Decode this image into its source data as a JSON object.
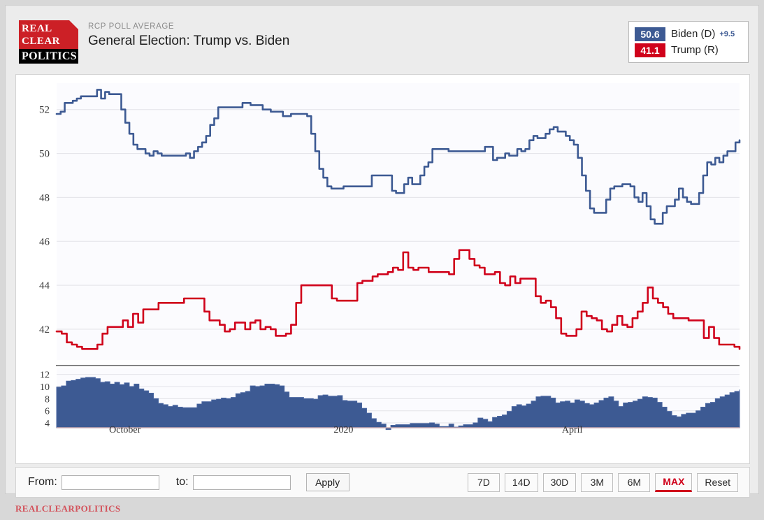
{
  "header": {
    "kicker": "RCP POLL AVERAGE",
    "title": "General Election: Trump vs. Biden",
    "logo": {
      "line1": "REAL",
      "line2": "CLEAR",
      "line3": "POLITICS"
    }
  },
  "legend": {
    "rows": [
      {
        "value": "50.6",
        "name": "Biden (D)",
        "delta": "+9.5",
        "color": "#3d5a93"
      },
      {
        "value": "41.1",
        "name": "Trump (R)",
        "delta": "",
        "color": "#d0021b"
      }
    ]
  },
  "controls": {
    "from_label": "From:",
    "from_value": "",
    "from_placeholder": "",
    "to_label": "to:",
    "to_value": "",
    "to_placeholder": "",
    "apply_label": "Apply",
    "ranges": [
      {
        "label": "7D",
        "active": false
      },
      {
        "label": "14D",
        "active": false
      },
      {
        "label": "30D",
        "active": false
      },
      {
        "label": "3M",
        "active": false
      },
      {
        "label": "6M",
        "active": false
      },
      {
        "label": "MAX",
        "active": true
      },
      {
        "label": "Reset",
        "active": false
      }
    ]
  },
  "footer": {
    "text": "REALCLEARPOLITICS"
  },
  "chart_data": {
    "type": "line",
    "title": "General Election: Trump vs. Biden",
    "subtitle": "RCP POLL AVERAGE",
    "xlabel": "",
    "ylabel": "",
    "ylim": [
      40.6,
      53.2
    ],
    "yticks": [
      42,
      44,
      46,
      48,
      50,
      52
    ],
    "grid": true,
    "legend_position": "top-right",
    "x_tick_labels": [
      "October",
      "2020",
      "April"
    ],
    "x_tick_positions": [
      0.1,
      0.42,
      0.755
    ],
    "series": [
      {
        "name": "Biden (D)",
        "color": "#3d5a93",
        "last_value": 50.6,
        "values": [
          51.8,
          51.9,
          52.3,
          52.3,
          52.4,
          52.5,
          52.6,
          52.6,
          52.6,
          52.6,
          52.9,
          52.5,
          52.8,
          52.7,
          52.7,
          52.7,
          52.0,
          51.4,
          50.9,
          50.4,
          50.2,
          50.2,
          50.0,
          49.9,
          50.1,
          50.0,
          49.9,
          49.9,
          49.9,
          49.9,
          49.9,
          49.9,
          50.0,
          49.8,
          50.1,
          50.3,
          50.5,
          50.8,
          51.3,
          51.6,
          52.1,
          52.1,
          52.1,
          52.1,
          52.1,
          52.1,
          52.3,
          52.3,
          52.2,
          52.2,
          52.2,
          52.0,
          52.0,
          51.9,
          51.9,
          51.9,
          51.7,
          51.7,
          51.8,
          51.8,
          51.8,
          51.8,
          51.7,
          50.9,
          50.1,
          49.3,
          48.9,
          48.5,
          48.4,
          48.4,
          48.4,
          48.5,
          48.5,
          48.5,
          48.5,
          48.5,
          48.5,
          48.5,
          49.0,
          49.0,
          49.0,
          49.0,
          49.0,
          48.3,
          48.2,
          48.2,
          48.6,
          48.9,
          48.6,
          48.6,
          49.0,
          49.4,
          49.6,
          50.2,
          50.2,
          50.2,
          50.2,
          50.1,
          50.1,
          50.1,
          50.1,
          50.1,
          50.1,
          50.1,
          50.1,
          50.1,
          50.3,
          50.3,
          49.7,
          49.8,
          49.8,
          50.0,
          49.9,
          49.9,
          50.2,
          50.1,
          50.2,
          50.6,
          50.8,
          50.7,
          50.7,
          50.9,
          51.1,
          51.2,
          51.0,
          51.0,
          50.8,
          50.6,
          50.4,
          49.8,
          49.0,
          48.3,
          47.5,
          47.3,
          47.3,
          47.3,
          47.9,
          48.4,
          48.5,
          48.5,
          48.6,
          48.6,
          48.5,
          48.0,
          47.8,
          48.2,
          47.6,
          47.0,
          46.8,
          46.8,
          47.3,
          47.6,
          47.6,
          47.9,
          48.4,
          48.0,
          47.8,
          47.7,
          47.7,
          48.2,
          49.0,
          49.6,
          49.5,
          49.8,
          49.6,
          49.9,
          50.1,
          50.1,
          50.5,
          50.6
        ]
      },
      {
        "name": "Trump (R)",
        "color": "#d0021b",
        "last_value": 41.1,
        "values": [
          41.9,
          41.8,
          41.4,
          41.3,
          41.2,
          41.1,
          41.1,
          41.1,
          41.3,
          41.8,
          42.1,
          42.1,
          42.1,
          42.4,
          42.1,
          42.7,
          42.3,
          42.9,
          42.9,
          42.9,
          43.2,
          43.2,
          43.2,
          43.2,
          43.2,
          43.4,
          43.4,
          43.4,
          43.4,
          42.8,
          42.4,
          42.4,
          42.2,
          41.9,
          42.0,
          42.3,
          42.3,
          42.0,
          42.3,
          42.4,
          42.0,
          42.1,
          42.0,
          41.7,
          41.7,
          41.8,
          42.2,
          43.2,
          44.0,
          44.0,
          44.0,
          44.0,
          44.0,
          44.0,
          43.4,
          43.3,
          43.3,
          43.3,
          43.3,
          44.1,
          44.2,
          44.2,
          44.4,
          44.5,
          44.5,
          44.6,
          44.8,
          44.7,
          45.5,
          44.8,
          44.7,
          44.8,
          44.8,
          44.6,
          44.6,
          44.6,
          44.6,
          44.5,
          45.2,
          45.6,
          45.6,
          45.2,
          44.9,
          44.8,
          44.5,
          44.5,
          44.6,
          44.1,
          44.0,
          44.4,
          44.1,
          44.3,
          44.3,
          44.3,
          43.5,
          43.2,
          43.3,
          43.0,
          42.5,
          41.8,
          41.7,
          41.7,
          42.0,
          42.8,
          42.6,
          42.5,
          42.4,
          42.0,
          41.9,
          42.2,
          42.6,
          42.2,
          42.1,
          42.5,
          42.8,
          43.2,
          43.9,
          43.4,
          43.2,
          43.0,
          42.7,
          42.5,
          42.5,
          42.5,
          42.4,
          42.4,
          42.4,
          41.6,
          42.1,
          41.6,
          41.3,
          41.3,
          41.3,
          41.2,
          41.1
        ]
      }
    ],
    "navigator": {
      "type": "area",
      "name": "Spread",
      "color": "#3d5a93",
      "yticks": [
        4,
        6,
        8,
        10,
        12
      ],
      "ylim": [
        3.2,
        13.0
      ],
      "values": [
        9.9,
        10.1,
        10.9,
        11.0,
        11.2,
        11.4,
        11.5,
        11.5,
        11.3,
        10.7,
        10.8,
        10.4,
        10.7,
        10.3,
        10.6,
        10.0,
        10.4,
        9.6,
        9.3,
        8.9,
        8.0,
        7.2,
        7.0,
        6.7,
        6.9,
        6.6,
        6.5,
        6.5,
        6.5,
        7.1,
        7.5,
        7.5,
        7.8,
        7.9,
        8.1,
        8.0,
        8.2,
        8.8,
        9.0,
        9.2,
        10.1,
        10.0,
        10.1,
        10.4,
        10.4,
        10.3,
        10.1,
        9.1,
        8.2,
        8.2,
        8.2,
        8.0,
        8.0,
        7.9,
        8.5,
        8.6,
        8.4,
        8.4,
        8.5,
        7.7,
        7.6,
        7.6,
        7.3,
        6.4,
        5.6,
        4.7,
        4.1,
        3.8,
        2.9,
        3.6,
        3.7,
        3.7,
        3.7,
        3.9,
        3.9,
        3.9,
        3.9,
        4.0,
        3.8,
        3.4,
        3.4,
        3.8,
        3.3,
        3.5,
        3.7,
        3.7,
        4.0,
        4.8,
        4.6,
        4.2,
        4.9,
        5.1,
        5.3,
        5.9,
        6.7,
        7.0,
        6.8,
        7.1,
        7.6,
        8.3,
        8.4,
        8.4,
        8.1,
        7.3,
        7.5,
        7.6,
        7.3,
        7.8,
        7.6,
        7.2,
        7.0,
        7.3,
        7.7,
        8.1,
        8.3,
        7.6,
        6.7,
        7.3,
        7.4,
        7.6,
        7.9,
        8.3,
        8.2,
        8.1,
        7.4,
        6.6,
        5.9,
        5.2,
        5.0,
        5.4,
        5.6,
        5.6,
        6.0,
        6.6,
        7.2,
        7.4,
        8.0,
        8.3,
        8.6,
        9.0,
        9.2,
        9.5
      ]
    }
  }
}
